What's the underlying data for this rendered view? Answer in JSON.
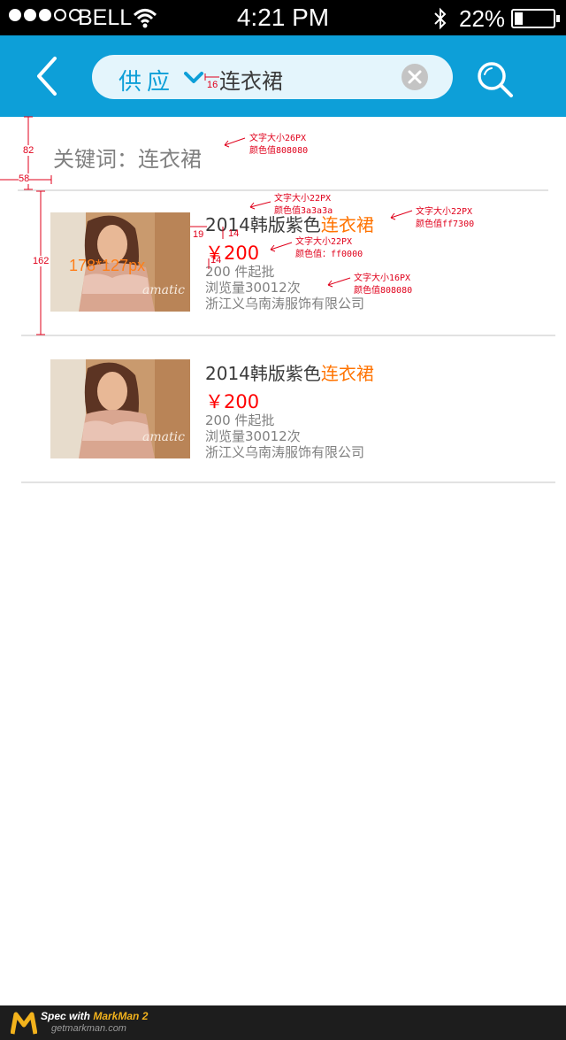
{
  "status_bar": {
    "carrier": "BELL",
    "time": "4:21 PM",
    "battery_percent": "22%",
    "battery_level": 0.22,
    "signal_bars_filled": 3,
    "signal_bars_total": 5
  },
  "nav": {
    "back_icon": "chevron-left-icon",
    "scope_label": "供应",
    "scope_icon": "chevron-down-icon",
    "query": "连衣裙",
    "clear_icon": "close-icon",
    "search_icon": "search-icon"
  },
  "keyword_label": "关键词：连衣裙",
  "products": [
    {
      "title_prefix": "2014韩版紫色",
      "title_highlight": "连衣裙",
      "price": "￥200",
      "min_order": "200 件起批",
      "views": "浏览量30012次",
      "supplier": "浙江义乌南涛服饰有限公司"
    },
    {
      "title_prefix": "2014韩版紫色",
      "title_highlight": "连衣裙",
      "price": "￥200",
      "min_order": "200 件起批",
      "views": "浏览量30012次",
      "supplier": "浙江义乌南涛服饰有限公司"
    }
  ],
  "annotations": {
    "keyword_note_1": "文字大小26PX",
    "keyword_note_2": "颜色值808080",
    "title_note_1": "文字大小22PX",
    "title_note_2": "颜色值3a3a3a",
    "highlight_note_1": "文字大小22PX",
    "highlight_note_2": "颜色值ff7300",
    "price_note_1": "文字大小22PX",
    "price_note_2": "颜色值：ff0000",
    "meta_note_1": "文字大小16PX",
    "meta_note_2": "颜色值808080",
    "image_size": "178*127px",
    "dim_16": "16",
    "dim_82": "82",
    "dim_58": "58",
    "dim_162": "162",
    "dim_19": "19",
    "dim_14a": "14",
    "dim_14b": "14"
  },
  "footer": {
    "spec_prefix": "Spec with ",
    "spec_brand": "MarkMan 2",
    "site": "getmarkman.com"
  },
  "colors": {
    "nav_bg": "#0d9fd8",
    "title": "#3a3a3a",
    "highlight": "#ff7300",
    "price": "#ff0000",
    "meta": "#808080",
    "annotation": "#e0001b"
  }
}
